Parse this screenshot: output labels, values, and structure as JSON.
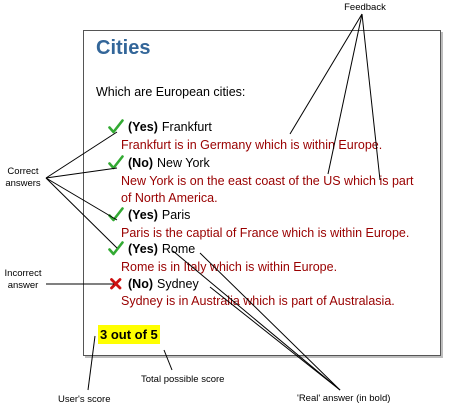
{
  "quiz": {
    "title": "Cities",
    "question": "Which are European cities:",
    "answers": [
      {
        "mark": "check-icon",
        "real": "(Yes)",
        "city": "Frankfurt",
        "feedback": "Frankfurt is in Germany which is within Europe."
      },
      {
        "mark": "check-icon",
        "real": "(No)",
        "city": "New York",
        "feedback": "New York is on the east coast of the US which is part of North America."
      },
      {
        "mark": "check-icon",
        "real": "(Yes)",
        "city": "Paris",
        "feedback": "Paris is the captial of France which is within Europe."
      },
      {
        "mark": "check-icon",
        "real": "(Yes)",
        "city": "Rome",
        "feedback": "Rome is in Italy which is within Europe."
      },
      {
        "mark": "cross-icon",
        "real": "(No)",
        "city": "Sydney",
        "feedback": "Sydney is in Australia which is part of Australasia."
      }
    ],
    "score": "3 out of 5"
  },
  "callouts": {
    "feedback": "Feedback",
    "correct_answers_line1": "Correct",
    "correct_answers_line2": "answers",
    "incorrect_answer_line1": "Incorrect",
    "incorrect_answer_line2": "answer",
    "users_score": "User's score",
    "total_possible_score": "Total possible score",
    "real_answer": "'Real' answer (in bold)"
  },
  "colors": {
    "title": "#336699",
    "feedback_text": "#990000",
    "check_mark": "#33aa33",
    "cross_mark": "#cc1111",
    "score_highlight": "#ffff00"
  }
}
